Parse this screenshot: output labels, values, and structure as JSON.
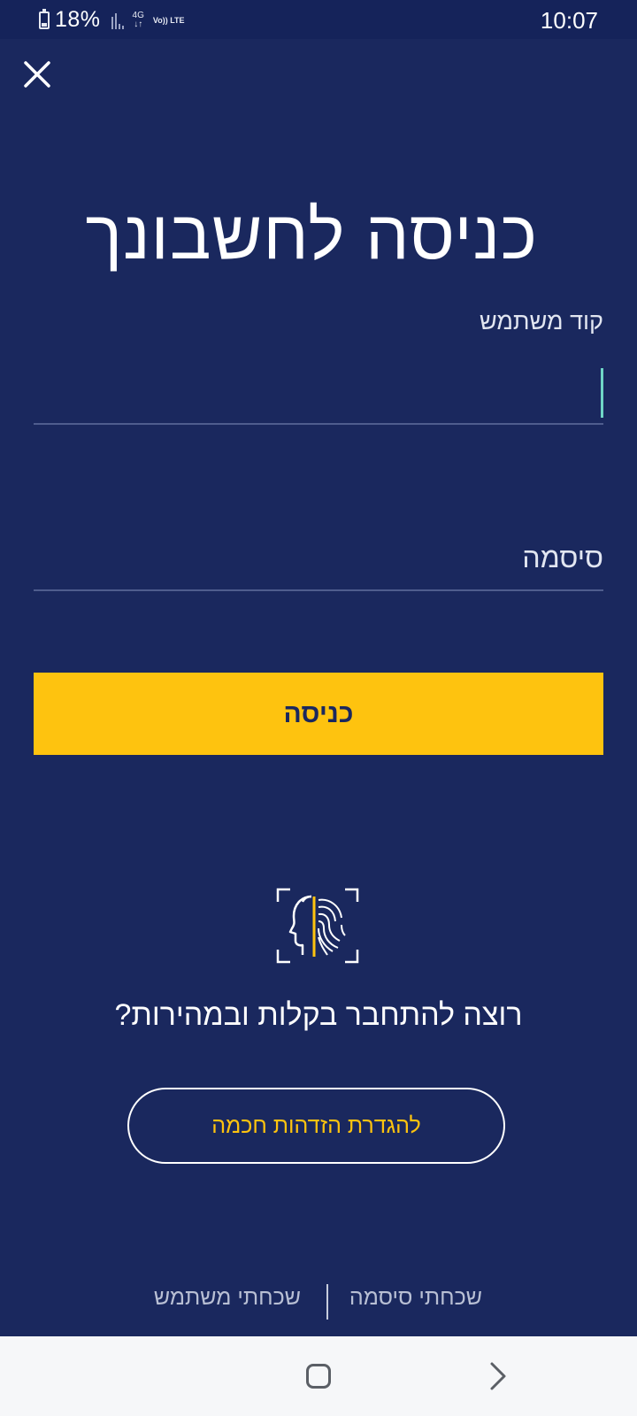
{
  "status_bar": {
    "battery": "18%",
    "network": "4G",
    "volte": "Vo)) LTE",
    "time": "10:07"
  },
  "page": {
    "title": "כניסה לחשבונך",
    "username_label": "קוד משתמש",
    "username_value": "",
    "password_label": "סיסמה",
    "password_value": "",
    "login_button": "כניסה",
    "biometric_question": "רוצה להתחבר בקלות ובמהירות?",
    "smart_id_button": "להגדרת הזדהות חכמה",
    "forgot_password": "שכחתי סיסמה",
    "forgot_username": "שכחתי משתמש"
  },
  "icons": {
    "close": "close-icon",
    "biometric": "face-fingerprint-icon",
    "home": "home-nav-icon",
    "back": "back-nav-icon"
  },
  "colors": {
    "background": "#1a285e",
    "accent": "#fec30f",
    "cursor": "#6fd6c7"
  }
}
